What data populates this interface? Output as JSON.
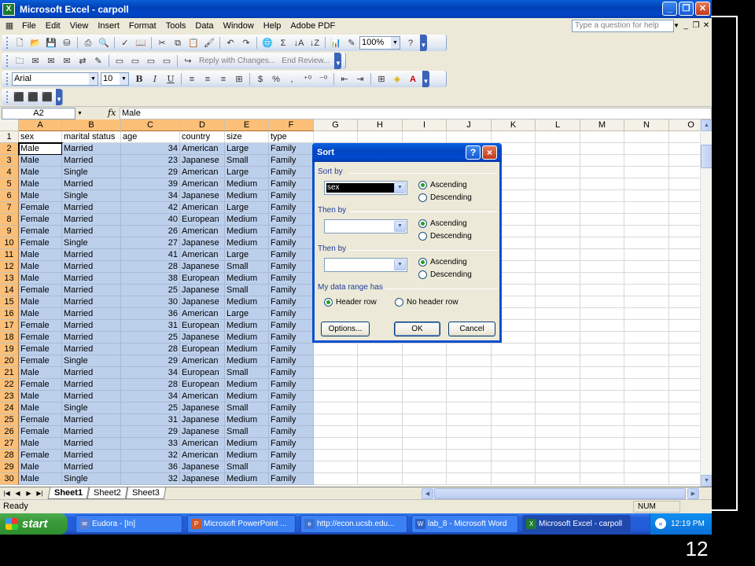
{
  "window": {
    "title": "Microsoft Excel - carpoll",
    "app_icon": "excel-icon"
  },
  "menu": [
    "File",
    "Edit",
    "View",
    "Insert",
    "Format",
    "Tools",
    "Data",
    "Window",
    "Help",
    "Adobe PDF"
  ],
  "help_box": {
    "placeholder": "Type a question for help"
  },
  "toolbar": {
    "zoom": "100%",
    "reviewing": {
      "reply": "Reply with Changes...",
      "end_review": "End Review..."
    },
    "font_name": "Arial",
    "font_size": "10",
    "bold": "B",
    "italic": "I",
    "underline": "U",
    "currency": "$",
    "percent": "%",
    "comma": ",",
    "sum": "Σ"
  },
  "formula_bar": {
    "name_box": "A2",
    "fx": "fx",
    "value": "Male"
  },
  "sheet": {
    "columns": [
      "A",
      "B",
      "C",
      "D",
      "E",
      "F",
      "G",
      "H",
      "I",
      "J",
      "K",
      "L",
      "M",
      "N",
      "O"
    ],
    "row_numbers": [
      "1",
      "2",
      "3",
      "4",
      "5",
      "6",
      "7",
      "8",
      "9",
      "10",
      "11",
      "12",
      "13",
      "14",
      "15",
      "16",
      "17",
      "18",
      "19",
      "20",
      "21",
      "22",
      "23",
      "24",
      "25",
      "26",
      "27",
      "28",
      "29",
      "30"
    ],
    "headers": [
      "sex",
      "marital status",
      "age",
      "country",
      "size",
      "type"
    ],
    "rows": [
      [
        "Male",
        "Married",
        "34",
        "American",
        "Large",
        "Family"
      ],
      [
        "Male",
        "Married",
        "23",
        "Japanese",
        "Small",
        "Family"
      ],
      [
        "Male",
        "Single",
        "29",
        "American",
        "Large",
        "Family"
      ],
      [
        "Male",
        "Married",
        "39",
        "American",
        "Medium",
        "Family"
      ],
      [
        "Male",
        "Single",
        "34",
        "Japanese",
        "Medium",
        "Family"
      ],
      [
        "Female",
        "Married",
        "42",
        "American",
        "Large",
        "Family"
      ],
      [
        "Female",
        "Married",
        "40",
        "European",
        "Medium",
        "Family"
      ],
      [
        "Female",
        "Married",
        "26",
        "American",
        "Medium",
        "Family"
      ],
      [
        "Female",
        "Single",
        "27",
        "Japanese",
        "Medium",
        "Family"
      ],
      [
        "Male",
        "Married",
        "41",
        "American",
        "Large",
        "Family"
      ],
      [
        "Male",
        "Married",
        "28",
        "Japanese",
        "Small",
        "Family"
      ],
      [
        "Male",
        "Married",
        "38",
        "European",
        "Medium",
        "Family"
      ],
      [
        "Female",
        "Married",
        "25",
        "Japanese",
        "Small",
        "Family"
      ],
      [
        "Male",
        "Married",
        "30",
        "Japanese",
        "Medium",
        "Family"
      ],
      [
        "Male",
        "Married",
        "36",
        "American",
        "Large",
        "Family"
      ],
      [
        "Female",
        "Married",
        "31",
        "European",
        "Medium",
        "Family"
      ],
      [
        "Female",
        "Married",
        "25",
        "Japanese",
        "Medium",
        "Family"
      ],
      [
        "Female",
        "Married",
        "28",
        "European",
        "Medium",
        "Family"
      ],
      [
        "Female",
        "Single",
        "29",
        "American",
        "Medium",
        "Family"
      ],
      [
        "Male",
        "Married",
        "34",
        "European",
        "Small",
        "Family"
      ],
      [
        "Female",
        "Married",
        "28",
        "European",
        "Medium",
        "Family"
      ],
      [
        "Male",
        "Married",
        "34",
        "American",
        "Medium",
        "Family"
      ],
      [
        "Male",
        "Single",
        "25",
        "Japanese",
        "Small",
        "Family"
      ],
      [
        "Female",
        "Married",
        "31",
        "Japanese",
        "Medium",
        "Family"
      ],
      [
        "Female",
        "Married",
        "29",
        "Japanese",
        "Small",
        "Family"
      ],
      [
        "Male",
        "Married",
        "33",
        "American",
        "Medium",
        "Family"
      ],
      [
        "Female",
        "Married",
        "32",
        "American",
        "Medium",
        "Family"
      ],
      [
        "Male",
        "Married",
        "36",
        "Japanese",
        "Small",
        "Family"
      ],
      [
        "Male",
        "Single",
        "32",
        "Japanese",
        "Medium",
        "Family"
      ]
    ],
    "tabs": [
      "Sheet1",
      "Sheet2",
      "Sheet3"
    ],
    "active_tab": "Sheet1",
    "selection_color": "#bcd0ec"
  },
  "status": {
    "text": "Ready",
    "num": "NUM"
  },
  "dialog": {
    "title": "Sort",
    "help": "?",
    "close": "×",
    "sort_by_label": "Sort by",
    "sort_by_value": "sex",
    "then_by_1_label": "Then by",
    "then_by_1_value": "",
    "then_by_2_label": "Then by",
    "then_by_2_value": "",
    "ascending": "Ascending",
    "descending": "Descending",
    "range_label": "My data range has",
    "header_row": "Header row",
    "no_header_row": "No header row",
    "options": "Options...",
    "ok": "OK",
    "cancel": "Cancel"
  },
  "taskbar": {
    "start": "start",
    "tasks": [
      {
        "label": "Eudora - [In]",
        "icon": "eudora-icon",
        "color": "#5b7fd4"
      },
      {
        "label": "Microsoft PowerPoint ...",
        "icon": "powerpoint-icon",
        "color": "#d0582a"
      },
      {
        "label": "http://econ.ucsb.edu...",
        "icon": "browser-icon",
        "color": "#3a71d0"
      },
      {
        "label": "lab_8 - Microsoft Word",
        "icon": "word-icon",
        "color": "#2c5dc4"
      },
      {
        "label": "Microsoft Excel - carpoll",
        "icon": "excel-icon",
        "color": "#1d7a2f"
      }
    ],
    "clock": "12:19 PM"
  },
  "slide_number": "12"
}
